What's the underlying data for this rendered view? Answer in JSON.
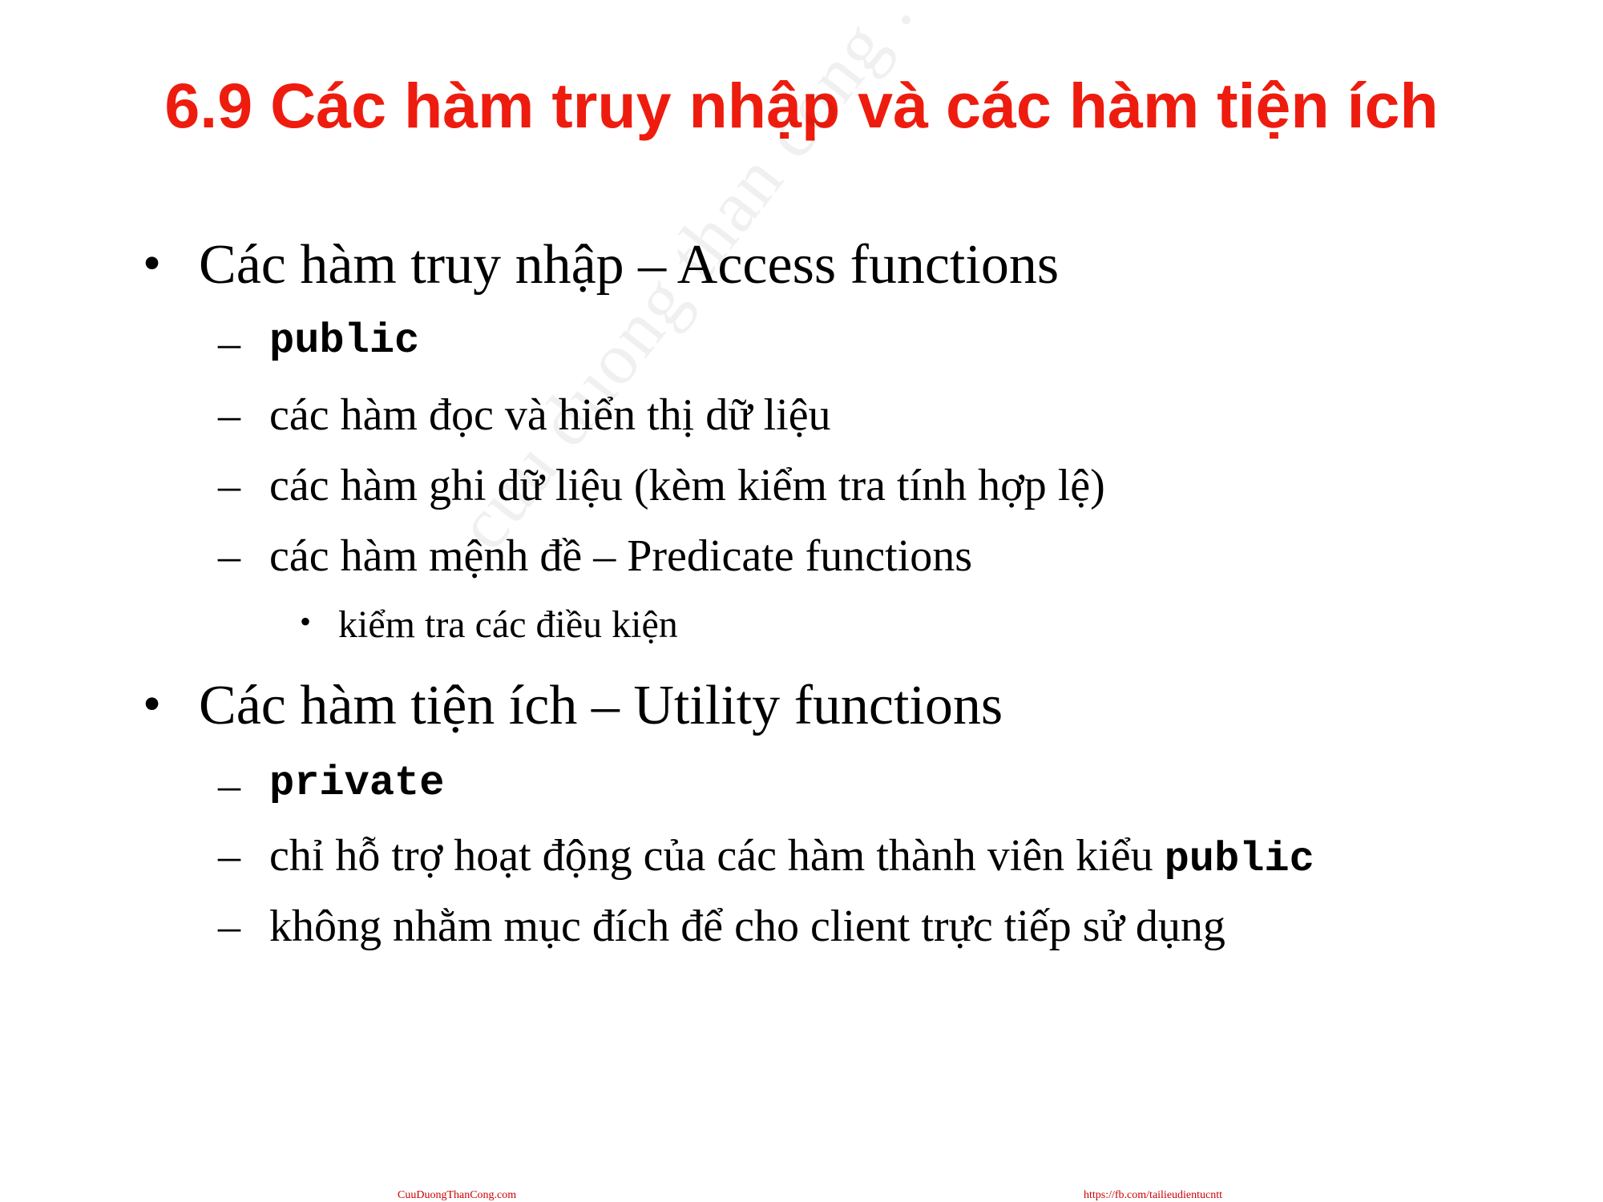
{
  "slide": {
    "title": "6.9 Các hàm truy nhập và các hàm tiện ích",
    "watermark": "cuu duong than cong . com",
    "bullet_mark": "•",
    "dash_mark": "–",
    "sections": [
      {
        "heading": "Các hàm truy nhập – Access functions",
        "items": [
          {
            "code": "public"
          },
          {
            "text": "các hàm đọc và hiển thị dữ liệu"
          },
          {
            "text": "các hàm ghi dữ liệu (kèm kiểm tra tính hợp lệ)"
          },
          {
            "text": "các hàm mệnh đề  – Predicate functions"
          },
          {
            "subitem": "kiểm tra các điều kiện"
          }
        ]
      },
      {
        "heading": "Các hàm tiện ích – Utility functions",
        "items": [
          {
            "code": "private"
          },
          {
            "text": "chỉ hỗ trợ hoạt động của các hàm thành viên kiểu ",
            "code_suffix": "public"
          },
          {
            "text": "không nhằm mục đích để cho client trực tiếp sử dụng"
          }
        ]
      }
    ],
    "footer": {
      "left": "CuuDuongThanCong.com",
      "right": "https://fb.com/tailieudientucntt"
    }
  }
}
